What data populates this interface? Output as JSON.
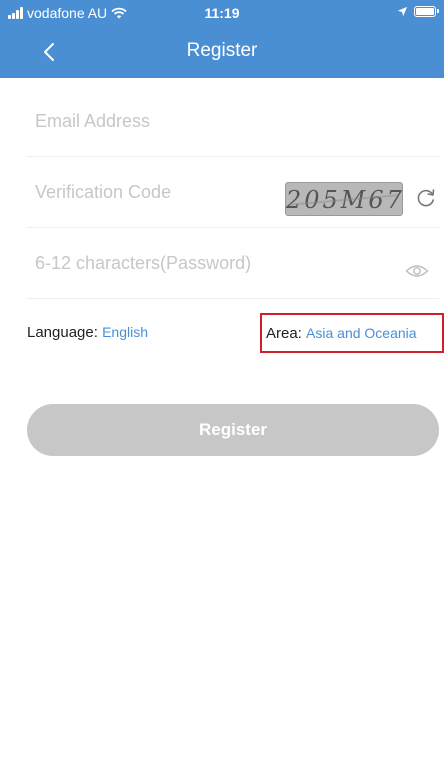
{
  "status": {
    "carrier": "vodafone AU",
    "time": "11:19"
  },
  "nav": {
    "title": "Register"
  },
  "form": {
    "email_placeholder": "Email Address",
    "code_placeholder": "Verification Code",
    "captcha_text": "205M67",
    "password_placeholder": "6-12 characters(Password)"
  },
  "settings": {
    "language_label": "Language:",
    "language_value": "English",
    "area_label": "Area:",
    "area_value": "Asia and Oceania"
  },
  "actions": {
    "register_label": "Register"
  },
  "colors": {
    "header": "#4a8fd4",
    "link": "#4a8fd4",
    "button_disabled": "#c7c7c7",
    "highlight_border": "#d01f2c"
  },
  "icons": [
    "signal-icon",
    "wifi-icon",
    "location-arrow-icon",
    "battery-icon",
    "back-icon",
    "refresh-icon",
    "eye-icon"
  ]
}
